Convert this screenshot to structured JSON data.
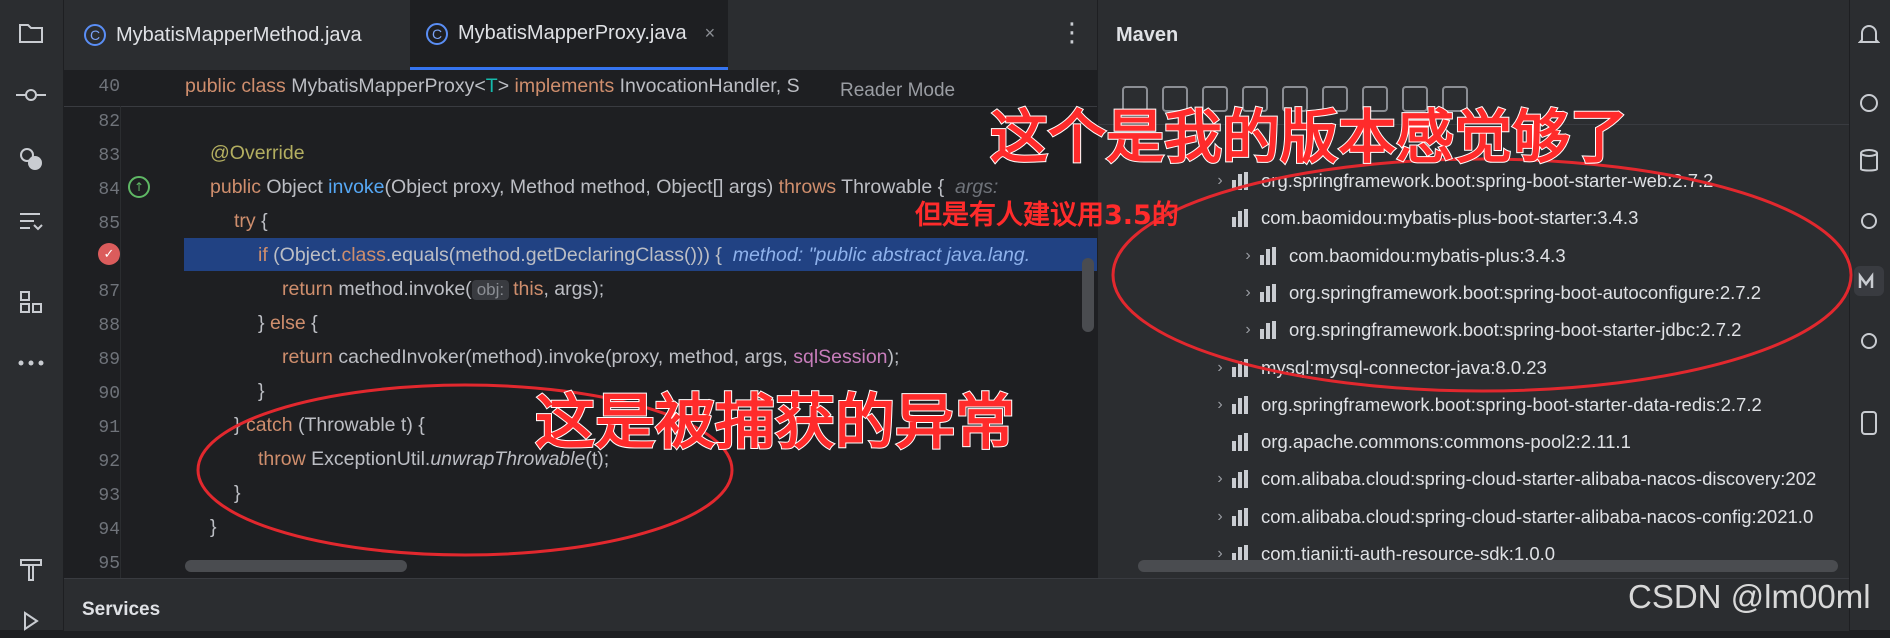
{
  "tabs": [
    {
      "icon": "C",
      "label": "MybatisMapperMethod.java"
    },
    {
      "icon": "C",
      "label": "MybatisMapperProxy.java",
      "close": "×"
    }
  ],
  "tabs_more": "⋮",
  "reader_mode": "Reader Mode",
  "sticky": {
    "line": "40"
  },
  "lines": [
    "82",
    "83",
    "84",
    "85",
    "86",
    "87",
    "88",
    "89",
    "90",
    "91",
    "92",
    "93",
    "94",
    "95"
  ],
  "code": {
    "l40_a": "public class ",
    "l40_b": "MybatisMapperProxy<",
    "l40_c": "T",
    "l40_d": "> ",
    "l40_e": "implements ",
    "l40_f": "InvocationHandler, S",
    "l83": "@Override",
    "l84_a": "public ",
    "l84_b": "Object ",
    "l84_c": "invoke",
    "l84_d": "(Object proxy, Method method, Object[] args) ",
    "l84_e": "throws ",
    "l84_f": "Throwable {  ",
    "l84_g": "args:",
    "l85_a": "try",
    "l85_b": " {",
    "l86_a": "if ",
    "l86_b": "(Object.",
    "l86_c": "class",
    "l86_d": ".equals(method.getDeclaringClass())) {  ",
    "l86_e": "method: \"public abstract java.lang.",
    "l87_a": "return ",
    "l87_b": "method.invoke(",
    "l87_hint": "obj:",
    "l87_c": "this",
    "l87_d": ", args);",
    "l88_a": "} ",
    "l88_b": "else",
    "l88_c": " {",
    "l89_a": "return ",
    "l89_b": "cachedInvoker(method).invoke(proxy, method, args, ",
    "l89_c": "sqlSession",
    "l89_d": ");",
    "l90": "}",
    "l91_a": "} ",
    "l91_b": "catch ",
    "l91_c": "(Throwable t) {",
    "l92_a": "throw ",
    "l92_b": "ExceptionUtil.",
    "l92_c": "unwrapThrowable",
    "l92_d": "(t);",
    "l93": "}",
    "l94": "}"
  },
  "maven": {
    "title": "Maven",
    "deps": [
      {
        "label": "org.springframework.boot:spring-boot-starter-web:2.7.2",
        "expandable": true
      },
      {
        "label": "com.baomidou:mybatis-plus-boot-starter:3.4.3",
        "expandable": false
      },
      {
        "label": "com.baomidou:mybatis-plus:3.4.3",
        "expandable": true,
        "child": true
      },
      {
        "label": "org.springframework.boot:spring-boot-autoconfigure:2.7.2",
        "expandable": true,
        "child": true
      },
      {
        "label": "org.springframework.boot:spring-boot-starter-jdbc:2.7.2",
        "expandable": true,
        "child": true
      },
      {
        "label": "mysql:mysql-connector-java:8.0.23",
        "expandable": true
      },
      {
        "label": "org.springframework.boot:spring-boot-starter-data-redis:2.7.2",
        "expandable": true
      },
      {
        "label": "org.apache.commons:commons-pool2:2.11.1",
        "expandable": false
      },
      {
        "label": "com.alibaba.cloud:spring-cloud-starter-alibaba-nacos-discovery:202",
        "expandable": true
      },
      {
        "label": "com.alibaba.cloud:spring-cloud-starter-alibaba-nacos-config:2021.0",
        "expandable": true
      },
      {
        "label": "com.tianji:tj-auth-resource-sdk:1.0.0",
        "expandable": true
      }
    ]
  },
  "bottom": {
    "services": "Services"
  },
  "annotations": {
    "version_ok": "这个是我的版本感觉够了",
    "suggest": "但是有人建议用3.5的",
    "caught": "这是被捕获的异常"
  },
  "watermark": "CSDN @lm00ml",
  "colors": {
    "accent": "#3574f0",
    "annotation": "#ff2b2b",
    "selection": "#214283"
  }
}
